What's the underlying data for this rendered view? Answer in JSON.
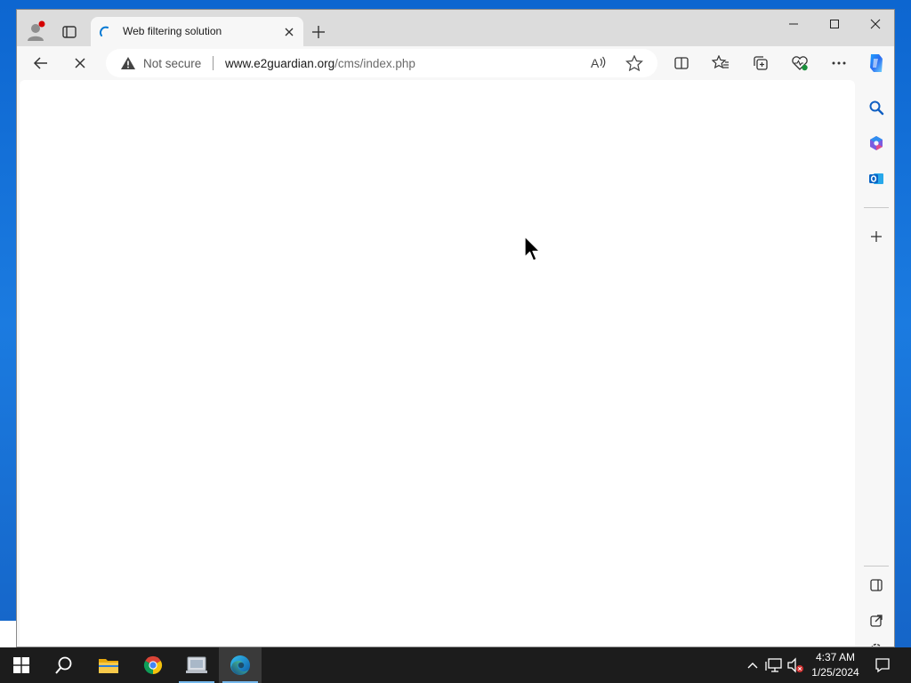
{
  "browser": {
    "tab": {
      "title": "Web filtering solution"
    },
    "address": {
      "security_label": "Not secure",
      "url_host": "www.e2guardian.org",
      "url_path": "/cms/index.php"
    },
    "icons": {
      "back": "back-arrow-icon",
      "stop": "stop-loading-icon",
      "read_aloud": "read-aloud-icon",
      "favorite": "star-icon",
      "split_screen": "split-screen-icon",
      "favorites": "favorites-icon",
      "collections": "collections-icon",
      "browser_essentials": "browser-essentials-icon",
      "more": "more-icon",
      "copilot": "copilot-icon"
    },
    "sidebar": [
      "search-icon",
      "m365-icon",
      "outlook-icon",
      "add-icon",
      "sidebar-toggle-icon",
      "open-external-icon",
      "settings-icon"
    ]
  },
  "taskbar": {
    "apps": [
      "windows-start",
      "search",
      "file-explorer",
      "chrome",
      "app",
      "edge"
    ],
    "clock_time": "4:37 AM",
    "clock_date": "1/25/2024"
  },
  "colors": {
    "accent": "#0078d4",
    "warning": "#444444",
    "profile_dot": "#d40000"
  }
}
